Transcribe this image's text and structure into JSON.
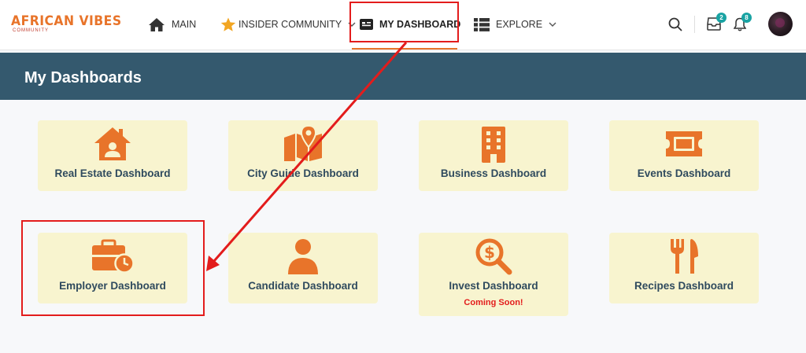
{
  "logo": {
    "title": "AFRICAN VIBES",
    "subtitle": "COMMUNITY"
  },
  "nav": {
    "main": "MAIN",
    "insider": "INSIDER COMMUNITY",
    "dashboard": "MY DASHBOARD",
    "explore": "EXPLORE"
  },
  "icons": {
    "inbox_badge": "2",
    "notifications_badge": "8"
  },
  "header": {
    "title": "My Dashboards"
  },
  "dashboards": [
    {
      "label": "Real Estate Dashboard",
      "icon": "house-user-icon"
    },
    {
      "label": "City Guide Dashboard",
      "icon": "map-location-icon"
    },
    {
      "label": "Business Dashboard",
      "icon": "building-icon"
    },
    {
      "label": "Events Dashboard",
      "icon": "ticket-icon"
    },
    {
      "label": "Employer Dashboard",
      "icon": "briefcase-clock-icon"
    },
    {
      "label": "Candidate Dashboard",
      "icon": "user-icon"
    },
    {
      "label": "Invest Dashboard",
      "icon": "search-dollar-icon",
      "note": "Coming Soon!"
    },
    {
      "label": "Recipes Dashboard",
      "icon": "utensils-icon"
    }
  ],
  "colors": {
    "accent": "#e8742a",
    "header_band": "#34596e",
    "card_bg": "#f8f4cf",
    "annotation_red": "#e31c1c",
    "badge": "#19a3a3"
  }
}
